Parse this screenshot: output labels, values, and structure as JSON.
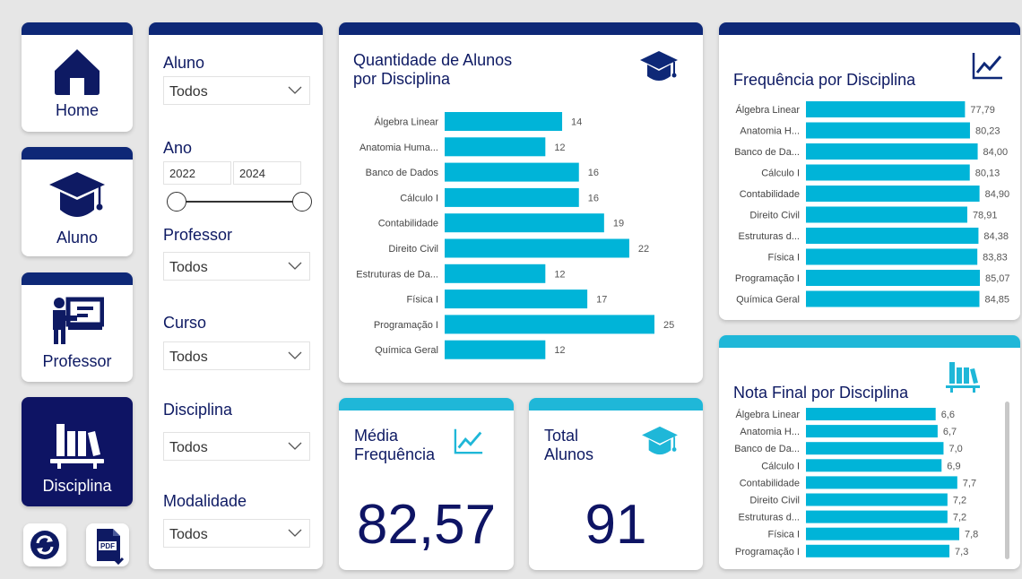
{
  "colors": {
    "navy": "#0e2877",
    "cyan": "#1fb7d8",
    "bar": "#00b4d8",
    "text_dark": "#0e1a63",
    "active_nav": "#0e1464"
  },
  "nav": {
    "items": [
      {
        "label": "Home",
        "icon": "home-icon"
      },
      {
        "label": "Aluno",
        "icon": "graduation-cap-icon"
      },
      {
        "label": "Professor",
        "icon": "teacher-board-icon"
      },
      {
        "label": "Disciplina",
        "icon": "library-books-icon",
        "active": true
      }
    ],
    "refresh_icon": "refresh-icon",
    "pdf_icon": "pdf-download-icon",
    "pdf_text": "PDF"
  },
  "filters": {
    "aluno": {
      "label": "Aluno",
      "value": "Todos"
    },
    "ano": {
      "label": "Ano",
      "from": "2022",
      "to": "2024"
    },
    "professor": {
      "label": "Professor",
      "value": "Todos"
    },
    "curso": {
      "label": "Curso",
      "value": "Todos"
    },
    "disciplina": {
      "label": "Disciplina",
      "value": "Todos"
    },
    "modalidade": {
      "label": "Modalidade",
      "value": "Todos"
    }
  },
  "kpis": {
    "media": {
      "title_line1": "Média",
      "title_line2": "Frequência",
      "value": "82,57",
      "icon": "line-chart-icon"
    },
    "total": {
      "title_line1": "Total",
      "title_line2": "Alunos",
      "value": "91",
      "icon": "graduation-cap-icon"
    }
  },
  "chart_titles": {
    "quantidade_line1": "Quantidade de Alunos",
    "quantidade_line2": "por Disciplina",
    "frequencia": "Frequência por Disciplina",
    "nota": "Nota Final por Disciplina"
  },
  "chart_data": [
    {
      "type": "bar",
      "orientation": "horizontal",
      "title": "Quantidade de Alunos por Disciplina",
      "categories": [
        "Álgebra Linear",
        "Anatomia Huma...",
        "Banco de Dados",
        "Cálculo I",
        "Contabilidade",
        "Direito Civil",
        "Estruturas de Da...",
        "Física I",
        "Programação I",
        "Química Geral"
      ],
      "values": [
        14,
        12,
        16,
        16,
        19,
        22,
        12,
        17,
        25,
        12
      ],
      "value_labels": [
        "14",
        "12",
        "16",
        "16",
        "19",
        "22",
        "12",
        "17",
        "25",
        "12"
      ],
      "xlim": [
        0,
        25
      ],
      "grid": false
    },
    {
      "type": "bar",
      "orientation": "horizontal",
      "title": "Frequência por Disciplina",
      "categories": [
        "Álgebra Linear",
        "Anatomia H...",
        "Banco de Da...",
        "Cálculo I",
        "Contabilidade",
        "Direito Civil",
        "Estruturas d...",
        "Física I",
        "Programação I",
        "Química Geral"
      ],
      "values": [
        77.79,
        80.23,
        84.0,
        80.13,
        84.9,
        78.91,
        84.38,
        83.83,
        85.07,
        84.85
      ],
      "value_labels": [
        "77,79",
        "80,23",
        "84,00",
        "80,13",
        "84,90",
        "78,91",
        "84,38",
        "83,83",
        "85,07",
        "84,85"
      ],
      "xlim": [
        0,
        85.07
      ],
      "grid": false
    },
    {
      "type": "bar",
      "orientation": "horizontal",
      "title": "Nota Final por Disciplina",
      "categories": [
        "Álgebra Linear",
        "Anatomia H...",
        "Banco de Da...",
        "Cálculo I",
        "Contabilidade",
        "Direito Civil",
        "Estruturas d...",
        "Física I",
        "Programação I"
      ],
      "values": [
        6.6,
        6.7,
        7.0,
        6.9,
        7.7,
        7.2,
        7.2,
        7.8,
        7.3
      ],
      "value_labels": [
        "6,6",
        "6,7",
        "7,0",
        "6,9",
        "7,7",
        "7,2",
        "7,2",
        "7,8",
        "7,3"
      ],
      "xlim": [
        0,
        7.8
      ],
      "grid": false
    }
  ]
}
